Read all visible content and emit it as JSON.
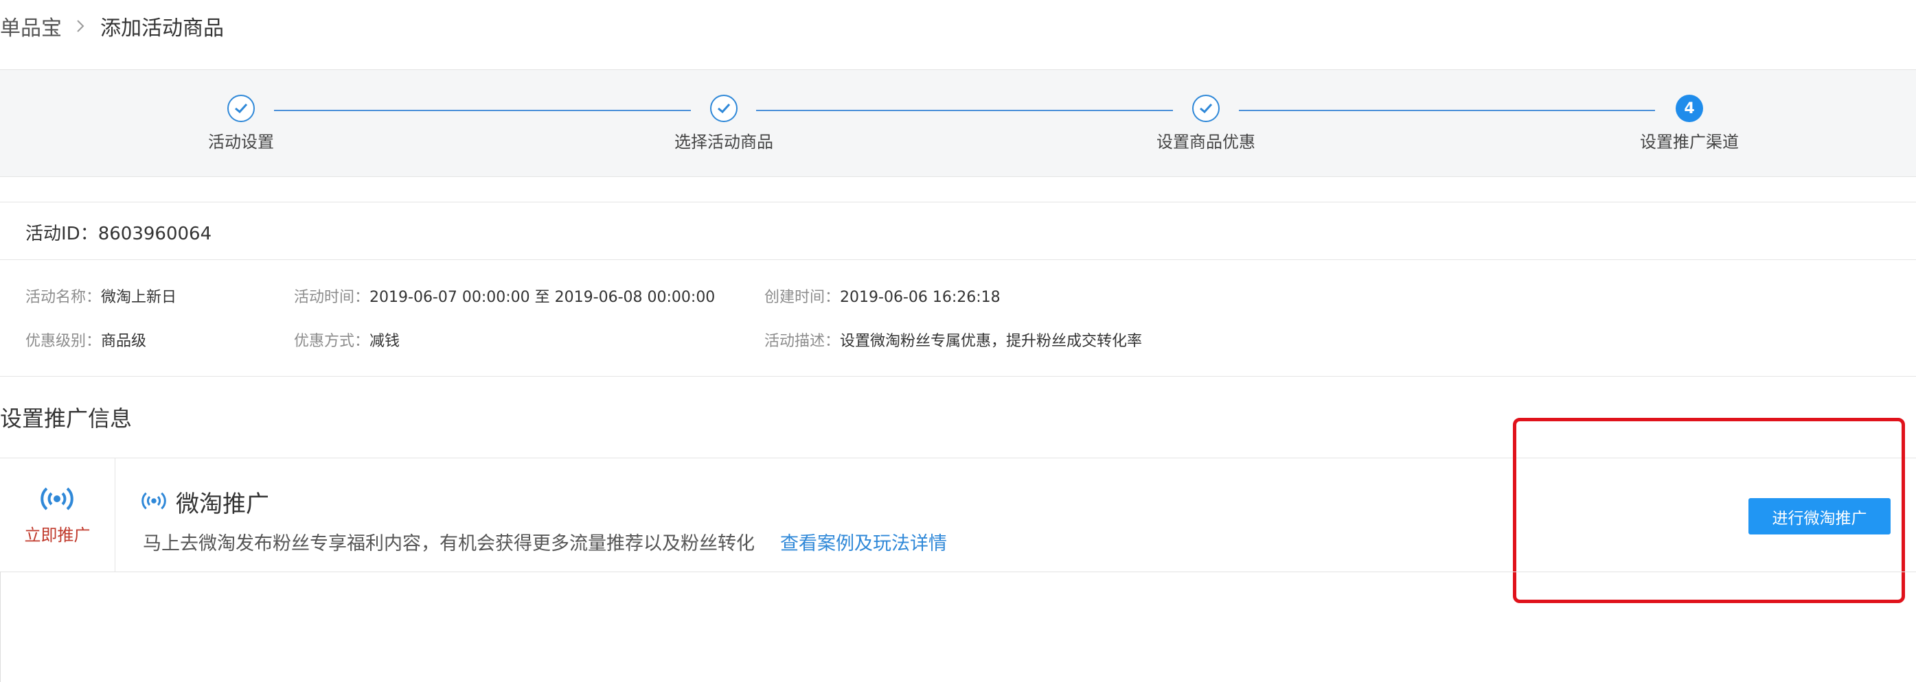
{
  "breadcrumb": {
    "root": "单品宝",
    "current": "添加活动商品"
  },
  "steps": [
    {
      "label": "活动设置",
      "state": "done"
    },
    {
      "label": "选择活动商品",
      "state": "done"
    },
    {
      "label": "设置商品优惠",
      "state": "done"
    },
    {
      "label": "设置推广渠道",
      "state": "current",
      "number": "4"
    }
  ],
  "activity": {
    "id_label": "活动ID：",
    "id_value": "8603960064",
    "fields": {
      "name": {
        "label": "活动名称：",
        "value": "微淘上新日"
      },
      "time": {
        "label": "活动时间：",
        "value": "2019-06-07 00:00:00 至 2019-06-08 00:00:00"
      },
      "created": {
        "label": "创建时间：",
        "value": "2019-06-06 16:26:18"
      },
      "level": {
        "label": "优惠级别：",
        "value": "商品级"
      },
      "method": {
        "label": "优惠方式：",
        "value": "减钱"
      },
      "desc": {
        "label": "活动描述：",
        "value": "设置微淘粉丝专属优惠，提升粉丝成交转化率"
      }
    }
  },
  "promo": {
    "section_title": "设置推广信息",
    "left_label": "立即推广",
    "title": "微淘推广",
    "description": "马上去微淘发布粉丝专享福利内容，有机会获得更多流量推荐以及粉丝转化",
    "link": "查看案例及玩法详情",
    "button": "进行微淘推广"
  },
  "colors": {
    "accent": "#2196f3",
    "step_line": "#4a90d9",
    "link": "#2f88d8",
    "highlight": "#e0121b",
    "promote_label": "#c0392b"
  },
  "icons": {
    "step_done": "check-icon",
    "breadcrumb_sep": "chevron-right-icon",
    "promo": "broadcast-icon"
  }
}
